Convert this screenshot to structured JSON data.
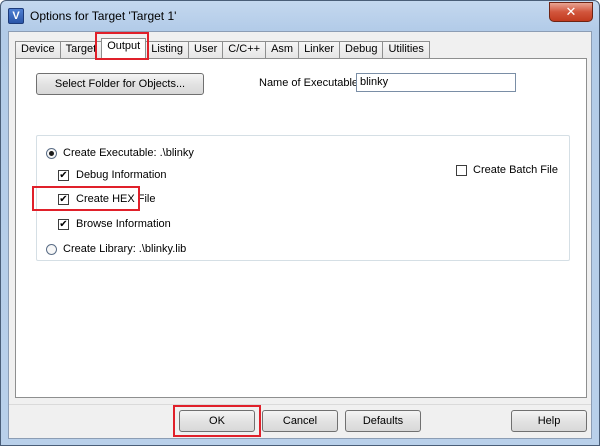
{
  "window": {
    "title": "Options for Target 'Target 1'",
    "close_label": "✕"
  },
  "tabs": [
    {
      "label": "Device"
    },
    {
      "label": "Target"
    },
    {
      "label": "Output",
      "active": true
    },
    {
      "label": "Listing"
    },
    {
      "label": "User"
    },
    {
      "label": "C/C++"
    },
    {
      "label": "Asm"
    },
    {
      "label": "Linker"
    },
    {
      "label": "Debug"
    },
    {
      "label": "Utilities"
    }
  ],
  "output": {
    "select_folder_label": "Select Folder for Objects...",
    "name_of_exe_label": "Name of Executable:",
    "name_of_exe_value": "blinky",
    "create_executable_label": "Create Executable:  .\\blinky",
    "create_executable_selected": true,
    "debug_info_label": "Debug Information",
    "debug_info_checked": true,
    "create_hex_label": "Create HEX File",
    "create_hex_checked": true,
    "browse_info_label": "Browse Information",
    "browse_info_checked": true,
    "create_batch_label": "Create Batch File",
    "create_batch_checked": false,
    "create_library_label": "Create Library:  .\\blinky.lib",
    "create_library_selected": false,
    "check_mark": "✔"
  },
  "footer": {
    "ok_label": "OK",
    "cancel_label": "Cancel",
    "defaults_label": "Defaults",
    "help_label": "Help"
  },
  "colors": {
    "highlight": "#e0202a"
  }
}
